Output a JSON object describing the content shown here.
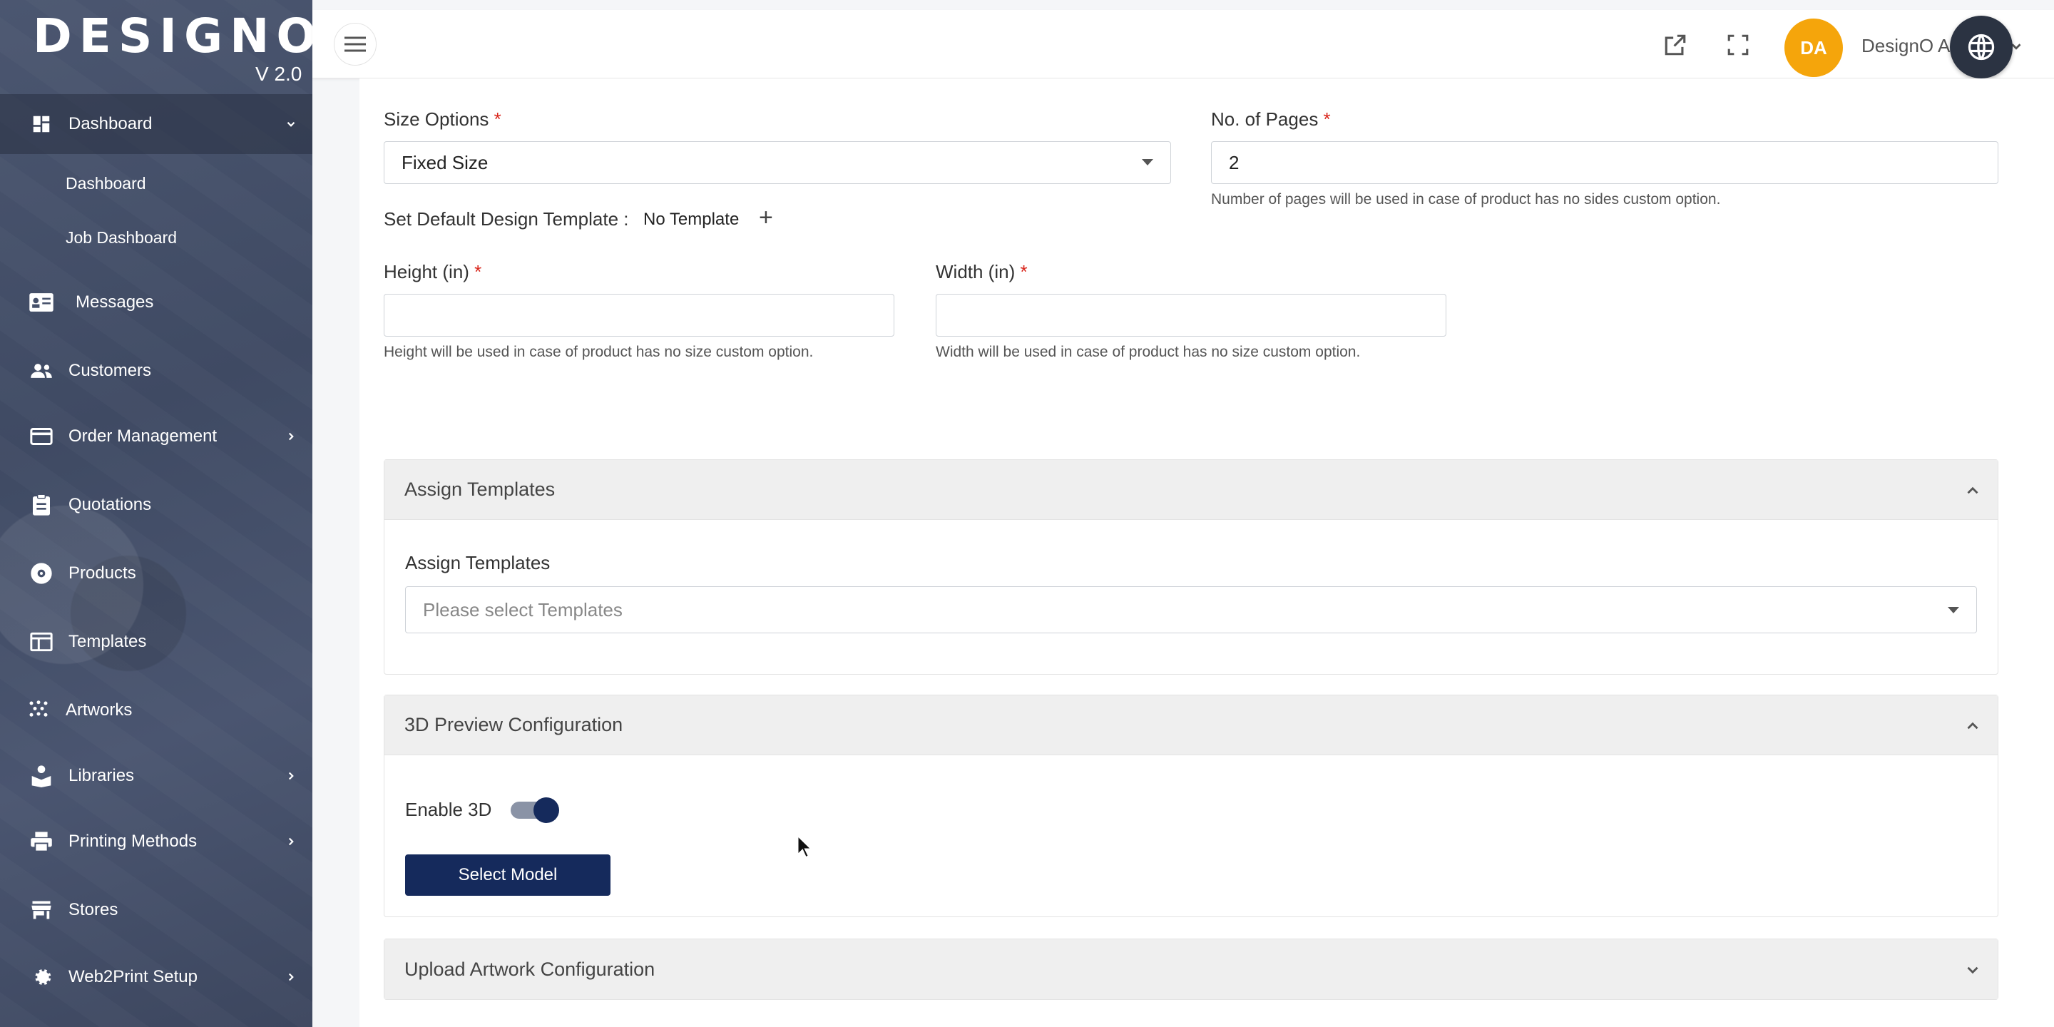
{
  "brand": {
    "name": "DESIGNO",
    "version": "V 2.0"
  },
  "sidebar": {
    "items": [
      {
        "label": "Dashboard",
        "icon": "dashboard-icon",
        "expanded": true
      },
      {
        "label": "Messages",
        "icon": "messages-icon"
      },
      {
        "label": "Customers",
        "icon": "customers-icon"
      },
      {
        "label": "Order Management",
        "icon": "credit-card-icon",
        "has_submenu": true
      },
      {
        "label": "Quotations",
        "icon": "clipboard-icon"
      },
      {
        "label": "Products",
        "icon": "products-icon"
      },
      {
        "label": "Templates",
        "icon": "templates-icon"
      },
      {
        "label": "Artworks",
        "icon": "artworks-icon"
      },
      {
        "label": "Libraries",
        "icon": "libraries-icon",
        "has_submenu": true
      },
      {
        "label": "Printing Methods",
        "icon": "printer-icon",
        "has_submenu": true
      },
      {
        "label": "Stores",
        "icon": "store-icon"
      },
      {
        "label": "Web2Print Setup",
        "icon": "gear-icon",
        "has_submenu": true
      }
    ],
    "dashboard_sub": [
      "Dashboard",
      "Job Dashboard"
    ]
  },
  "topbar": {
    "avatar_initials": "DA",
    "user_name": "DesignO A",
    "icons": [
      "menu-icon",
      "external-link-icon",
      "fullscreen-icon",
      "globe-icon"
    ]
  },
  "form": {
    "size_options": {
      "label": "Size Options",
      "required_mark": "*",
      "value": "Fixed Size"
    },
    "no_of_pages": {
      "label": "No. of Pages",
      "required_mark": "*",
      "value": "2",
      "help": "Number of pages will be used in case of product has no sides custom option."
    },
    "default_template": {
      "label": "Set Default Design Template :",
      "value": "No Template",
      "add_symbol": "+"
    },
    "height": {
      "label": "Height (in)",
      "required_mark": "*",
      "value": "",
      "help": "Height will be used in case of product has no size custom option."
    },
    "width": {
      "label": "Width (in)",
      "required_mark": "*",
      "value": "",
      "help": "Width will be used in case of product has no size custom option."
    }
  },
  "panels": {
    "assign_templates": {
      "title": "Assign Templates",
      "field_label": "Assign Templates",
      "placeholder": "Please select Templates",
      "expanded": true
    },
    "preview_3d": {
      "title": "3D Preview Configuration",
      "toggle_label": "Enable 3D",
      "toggle_on": true,
      "button_label": "Select Model",
      "expanded": true
    },
    "upload_artwork": {
      "title": "Upload Artwork Configuration",
      "expanded": false
    }
  },
  "colors": {
    "primary": "#152a5c",
    "avatar": "#f5a50b",
    "required": "#d9261c",
    "sidebar": "#46516b"
  }
}
